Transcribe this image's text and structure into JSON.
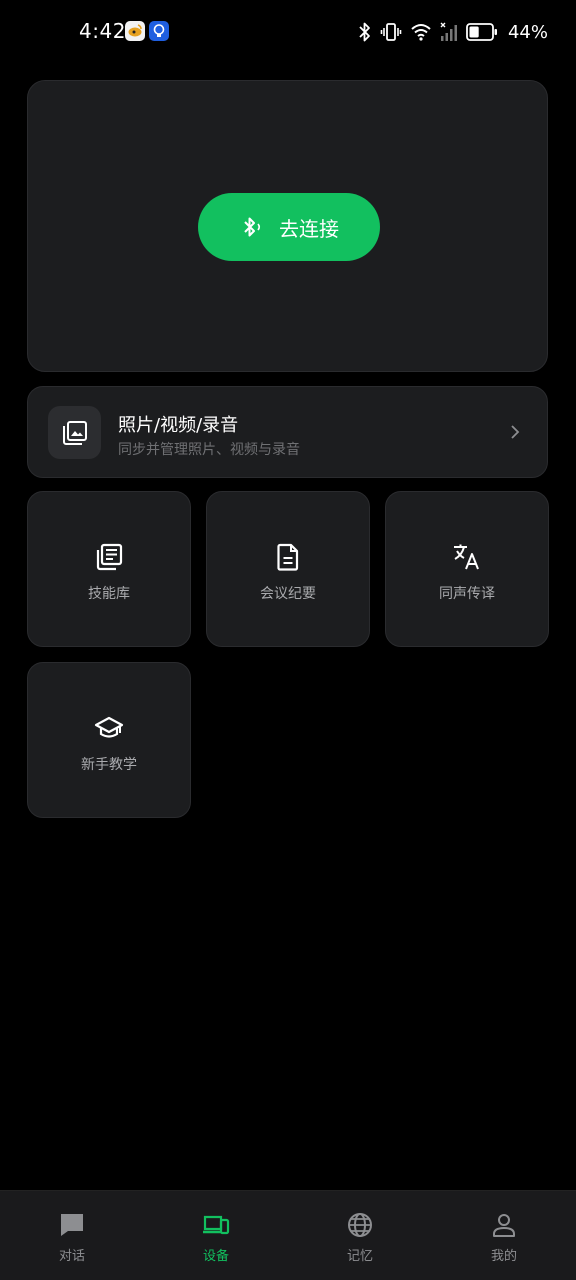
{
  "status_bar": {
    "time": "4:42",
    "battery_percent": "44%",
    "battery_level": 0.44
  },
  "connect": {
    "button_label": "去连接",
    "icon": "bluetooth-icon"
  },
  "media": {
    "title": "照片/视频/录音",
    "subtitle": "同步并管理照片、视频与录音",
    "icon": "photo-library-icon"
  },
  "features": [
    {
      "label": "技能库",
      "icon": "library-icon"
    },
    {
      "label": "会议纪要",
      "icon": "document-icon"
    },
    {
      "label": "同声传译",
      "icon": "translate-icon"
    },
    {
      "label": "新手教学",
      "icon": "graduation-cap-icon"
    }
  ],
  "bottom_nav": [
    {
      "label": "对话",
      "icon": "chat-icon",
      "active": false
    },
    {
      "label": "设备",
      "icon": "devices-icon",
      "active": true
    },
    {
      "label": "记忆",
      "icon": "globe-icon",
      "active": false
    },
    {
      "label": "我的",
      "icon": "person-icon",
      "active": false
    }
  ],
  "colors": {
    "accent": "#12c05f",
    "background": "#000000",
    "card": "#1c1d1f"
  }
}
